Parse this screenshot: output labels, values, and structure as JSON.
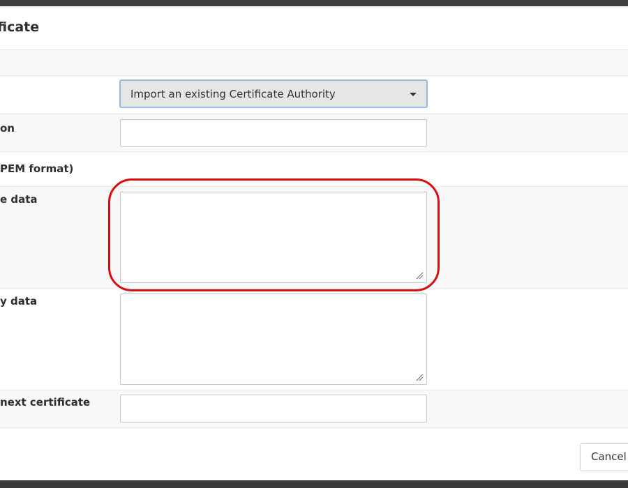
{
  "modal": {
    "title": "ficate",
    "fields": {
      "method_label": "",
      "method_value": "Import an existing Certificate Authority",
      "description_label": "on",
      "description_value": "",
      "section_heading": "PEM format)",
      "certificate_label": "e data",
      "certificate_value": "",
      "private_key_label": "y data",
      "private_key_value": "",
      "serial_label": "next certificate",
      "serial_value": ""
    },
    "footer": {
      "cancel_label": "Cancel"
    }
  },
  "colors": {
    "highlight": "#d90b0b",
    "select_border": "#9ab7e8",
    "select_background": "#e6e6e6"
  },
  "icons": {
    "select_caret": "chevron-down-icon",
    "textarea_grip": "resize-grip-icon"
  }
}
